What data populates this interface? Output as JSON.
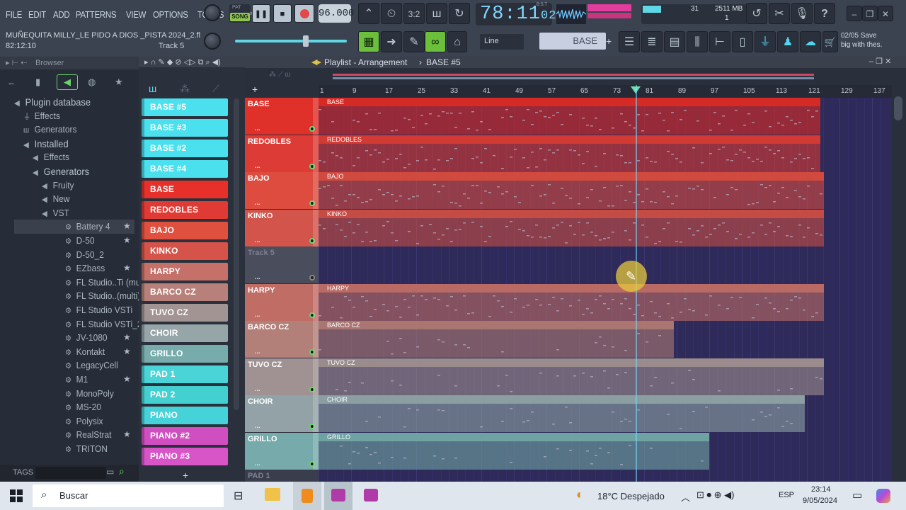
{
  "menu": [
    "FILE",
    "EDIT",
    "ADD",
    "PATTERNS",
    "VIEW",
    "OPTIONS",
    "TOOLS",
    "HELP"
  ],
  "transport": {
    "pat_label": "PAT",
    "song_label": "SONG",
    "tempo": "96.000",
    "time_main": "78:11",
    "time_sub": "02",
    "time_unit": "B:S:T"
  },
  "project": {
    "name": "MUÑEQUITA MILLY_LE PIDO A DIOS _PISTA 2024_2.fl",
    "position": "82:12:10",
    "track": "Track 5"
  },
  "cpu": {
    "value": "31",
    "memory": "2511 MB",
    "voices": "1"
  },
  "snap": "Line",
  "current_pattern": "BASE",
  "hint": {
    "line1": "02/05  Save",
    "line2": "big with thes."
  },
  "browser": {
    "title": "Browser",
    "items": [
      {
        "label": "Plugin database",
        "icon": "speaker-icon",
        "indent": 0,
        "big": true
      },
      {
        "label": "Effects",
        "icon": "plug-icon",
        "indent": 1
      },
      {
        "label": "Generators",
        "icon": "wave-icon",
        "indent": 1
      },
      {
        "label": "Installed",
        "icon": "speaker-icon",
        "indent": 1,
        "big": true
      },
      {
        "label": "Effects",
        "icon": "speaker-icon",
        "indent": 2
      },
      {
        "label": "Generators",
        "icon": "speaker-icon",
        "indent": 2,
        "big": true
      },
      {
        "label": "Fruity",
        "icon": "speaker-icon",
        "indent": 3
      },
      {
        "label": "New",
        "icon": "speaker-icon",
        "indent": 3
      },
      {
        "label": "VST",
        "icon": "speaker-icon",
        "indent": 3
      },
      {
        "label": "Battery 4",
        "icon": "gear-icon",
        "indent": 4,
        "star": true,
        "selected": true
      },
      {
        "label": "D-50",
        "icon": "gear-icon",
        "indent": 4,
        "star": true
      },
      {
        "label": "D-50_2",
        "icon": "gear-icon",
        "indent": 4
      },
      {
        "label": "EZbass",
        "icon": "gear-icon",
        "indent": 4,
        "star": true
      },
      {
        "label": "FL Studio..Ti (multi)",
        "icon": "gear-icon",
        "indent": 4
      },
      {
        "label": "FL Studio..(multi)_2",
        "icon": "gear-icon",
        "indent": 4
      },
      {
        "label": "FL Studio VSTi",
        "icon": "gear-icon",
        "indent": 4
      },
      {
        "label": "FL Studio VSTi_2",
        "icon": "gear-icon",
        "indent": 4
      },
      {
        "label": "JV-1080",
        "icon": "gear-icon",
        "indent": 4,
        "star": true
      },
      {
        "label": "Kontakt",
        "icon": "gear-icon",
        "indent": 4,
        "star": true
      },
      {
        "label": "LegacyCell",
        "icon": "gear-icon",
        "indent": 4
      },
      {
        "label": "M1",
        "icon": "gear-icon",
        "indent": 4,
        "star": true
      },
      {
        "label": "MonoPoly",
        "icon": "gear-icon",
        "indent": 4
      },
      {
        "label": "MS-20",
        "icon": "gear-icon",
        "indent": 4
      },
      {
        "label": "Polysix",
        "icon": "gear-icon",
        "indent": 4
      },
      {
        "label": "RealStrat",
        "icon": "gear-icon",
        "indent": 4,
        "star": true
      },
      {
        "label": "TRITON",
        "icon": "gear-icon",
        "indent": 4
      }
    ],
    "tags_label": "TAGS"
  },
  "playlist": {
    "title": "Playlist - Arrangement",
    "pattern": "BASE #5",
    "ruler": [
      "1",
      "9",
      "17",
      "25",
      "33",
      "41",
      "49",
      "57",
      "65",
      "73",
      "81",
      "89",
      "97",
      "105",
      "113",
      "121",
      "129",
      "137"
    ],
    "playhead": 0.553,
    "patterns": [
      {
        "label": "BASE #5",
        "color": "#4ae0ee"
      },
      {
        "label": "BASE #3",
        "color": "#4ae0ee"
      },
      {
        "label": "BASE #2",
        "color": "#4ae0ee"
      },
      {
        "label": "BASE #4",
        "color": "#4ae0ee"
      },
      {
        "label": "BASE",
        "color": "#e8302a"
      },
      {
        "label": "REDOBLES",
        "color": "#e03a35"
      },
      {
        "label": "BAJO",
        "color": "#e0503f"
      },
      {
        "label": "KINKO",
        "color": "#d6534a"
      },
      {
        "label": "HARPY",
        "color": "#c57068"
      },
      {
        "label": "BARCO CZ",
        "color": "#b8807a"
      },
      {
        "label": "TUVO CZ",
        "color": "#a39494"
      },
      {
        "label": "CHOIR",
        "color": "#95a5a8"
      },
      {
        "label": "GRILLO",
        "color": "#78acac"
      },
      {
        "label": "PAD 1",
        "color": "#4ad4d8"
      },
      {
        "label": "PAD 2",
        "color": "#44cfd0"
      },
      {
        "label": "PIANO",
        "color": "#45d2d8"
      },
      {
        "label": "PIANO #2",
        "color": "#d04fc0"
      },
      {
        "label": "PIANO #3",
        "color": "#d855c8"
      }
    ],
    "tracks": [
      {
        "name": "BASE",
        "color": "#e0302a",
        "clip": "BASE",
        "end": 0.875,
        "clipcolor": "#d62a26"
      },
      {
        "name": "REDOBLES",
        "color": "#dd3b35",
        "clip": "REDOBLES",
        "end": 0.875,
        "clipcolor": "#d23a34"
      },
      {
        "name": "BAJO",
        "color": "#dd4c3f",
        "clip": "BAJO",
        "end": 0.882,
        "clipcolor": "#d04a3f"
      },
      {
        "name": "KINKO",
        "color": "#d2544a",
        "clip": "KINKO",
        "end": 0.882,
        "clipcolor": "#c44c45"
      },
      {
        "name": "Track 5",
        "color": "#4a4d5c",
        "clip": "",
        "end": 0,
        "clipcolor": ""
      },
      {
        "name": "HARPY",
        "color": "#c06d66",
        "clip": "HARPY",
        "end": 0.882,
        "clipcolor": "#ba6a64"
      },
      {
        "name": "BARCO CZ",
        "color": "#b37f79",
        "clip": "BARCO CZ",
        "end": 0.62,
        "clipcolor": "#a97672"
      },
      {
        "name": "TUVO CZ",
        "color": "#a09292",
        "clip": "TUVO CZ",
        "end": 0.882,
        "clipcolor": "#9a8c8c"
      },
      {
        "name": "CHOIR",
        "color": "#92a2a6",
        "clip": "CHOIR",
        "end": 0.848,
        "clipcolor": "#8b9ea2"
      },
      {
        "name": "GRILLO",
        "color": "#77abab",
        "clip": "GRILLO",
        "end": 0.682,
        "clipcolor": "#6fa2a2"
      },
      {
        "name": "PAD 1",
        "color": "#3a3e4c",
        "clip": "",
        "end": 0,
        "clipcolor": ""
      }
    ]
  },
  "taskbar": {
    "search": "Buscar",
    "weather": "18°C  Despejado",
    "lang": "ESP",
    "time": "23:14",
    "date": "9/05/2024"
  }
}
